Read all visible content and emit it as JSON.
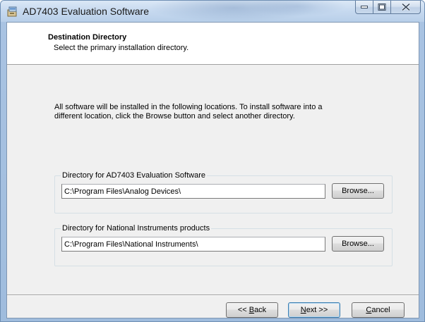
{
  "window": {
    "title": "AD7403 Evaluation Software",
    "icon": "installer-icon",
    "caption_buttons": [
      "minimize-icon",
      "maximize-icon",
      "close-icon"
    ]
  },
  "header": {
    "title": "Destination Directory",
    "subtitle": "Select the primary installation directory."
  },
  "intro": {
    "line1": "All software will be installed in the following locations. To install software into a",
    "line2": "different location, click the Browse button and select another directory."
  },
  "directories": [
    {
      "legend": "Directory for AD7403 Evaluation Software",
      "path": "C:\\Program Files\\Analog Devices\\",
      "browse_label": "Browse..."
    },
    {
      "legend": "Directory for National Instruments products",
      "path": "C:\\Program Files\\National Instruments\\",
      "browse_label": "Browse..."
    }
  ],
  "footer": {
    "back": {
      "prefix": "<< ",
      "mnemonic": "B",
      "rest": "ack"
    },
    "next": {
      "prefix": "",
      "mnemonic": "N",
      "rest": "ext >>"
    },
    "cancel": {
      "prefix": "",
      "mnemonic": "C",
      "rest": "ancel"
    }
  },
  "colors": {
    "title_bar": "#c6d9ef",
    "dialog_face": "#f0f0f0",
    "default_button_border": "#3c7fb1"
  }
}
